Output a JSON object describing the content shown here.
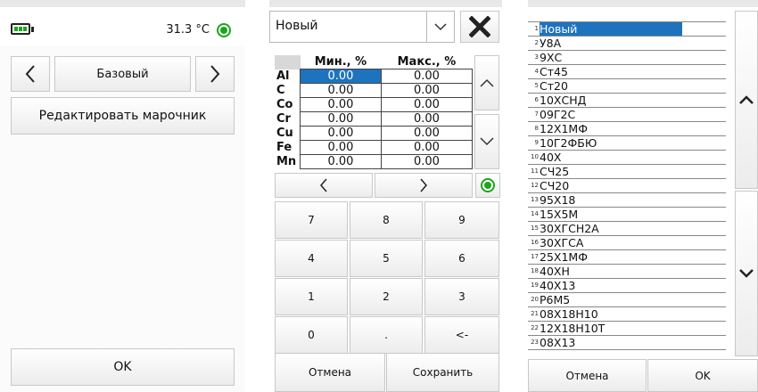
{
  "screen1": {
    "temperature": "31.3 °C",
    "status_color": "#1ca51c",
    "mode_label": "Базовый",
    "edit_button": "Редактировать марочник",
    "ok_button": "OK",
    "prev_icon": "chevron-left-icon",
    "next_icon": "chevron-right-icon"
  },
  "screen2": {
    "grade_select": "Новый",
    "close_icon": "close-icon",
    "columns": [
      "Мин., %",
      "Макс., %"
    ],
    "rows": [
      {
        "element": "Al",
        "min": "0.00",
        "max": "0.00"
      },
      {
        "element": "C",
        "min": "0.00",
        "max": "0.00"
      },
      {
        "element": "Co",
        "min": "0.00",
        "max": "0.00"
      },
      {
        "element": "Cr",
        "min": "0.00",
        "max": "0.00"
      },
      {
        "element": "Cu",
        "min": "0.00",
        "max": "0.00"
      },
      {
        "element": "Fe",
        "min": "0.00",
        "max": "0.00"
      },
      {
        "element": "Mn",
        "min": "0.00",
        "max": "0.00"
      }
    ],
    "keys": [
      "7",
      "8",
      "9",
      "4",
      "5",
      "6",
      "1",
      "2",
      "3",
      "0",
      ".",
      "<-"
    ],
    "cancel_button": "Отмена",
    "save_button": "Сохранить"
  },
  "screen3": {
    "grades": [
      {
        "num": "1",
        "name": "Новый"
      },
      {
        "num": "2",
        "name": "У8А"
      },
      {
        "num": "3",
        "name": "9ХС"
      },
      {
        "num": "4",
        "name": "Ст45"
      },
      {
        "num": "5",
        "name": "Ст20"
      },
      {
        "num": "6",
        "name": "10ХСНД"
      },
      {
        "num": "7",
        "name": "09Г2С"
      },
      {
        "num": "8",
        "name": "12Х1МФ"
      },
      {
        "num": "9",
        "name": "10Г2ФБЮ"
      },
      {
        "num": "10",
        "name": "40Х"
      },
      {
        "num": "11",
        "name": "СЧ25"
      },
      {
        "num": "12",
        "name": "СЧ20"
      },
      {
        "num": "13",
        "name": "95Х18"
      },
      {
        "num": "14",
        "name": "15Х5М"
      },
      {
        "num": "15",
        "name": "30ХГСН2А"
      },
      {
        "num": "16",
        "name": "30ХГСА"
      },
      {
        "num": "17",
        "name": "25Х1МФ"
      },
      {
        "num": "18",
        "name": "40ХН"
      },
      {
        "num": "19",
        "name": "40Х13"
      },
      {
        "num": "20",
        "name": "Р6М5"
      },
      {
        "num": "21",
        "name": "08Х18Н10"
      },
      {
        "num": "22",
        "name": "12Х18Н10Т"
      },
      {
        "num": "23",
        "name": "08Х13"
      }
    ],
    "cancel_button": "Отмена",
    "ok_button": "OK"
  },
  "colors": {
    "accent": "#1e73be",
    "status_green": "#1ca51c"
  }
}
